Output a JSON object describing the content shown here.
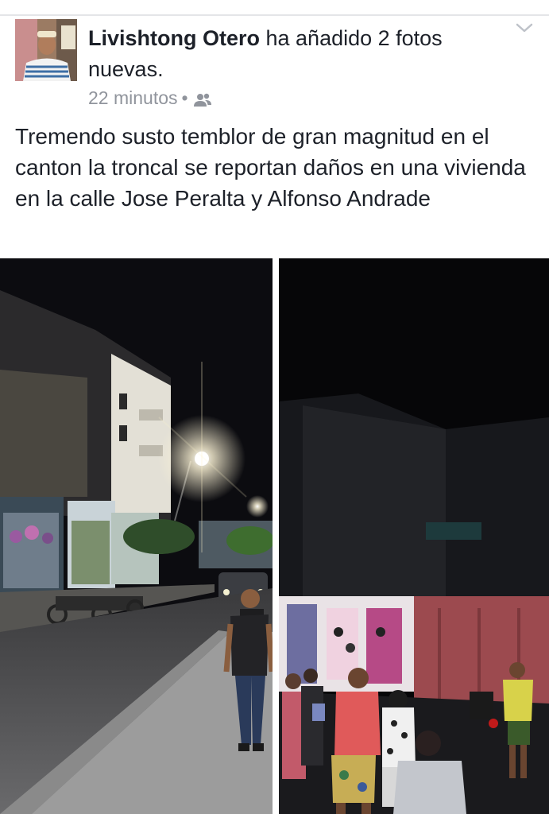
{
  "post": {
    "author": "Livishtong Otero",
    "action": " ha añadido 2 fotos nuevas.",
    "timestamp": "22 minutos",
    "separator": "•",
    "audience_icon": "friends-icon",
    "menu_icon": "chevron-down-icon",
    "text": "Tremendo susto temblor de gran magnitud  en el canton la troncal se reportan daños en una vivienda en la calle Jose Peralta y Alfonso Andrade"
  },
  "colors": {
    "text": "#1d2129",
    "meta": "#90949c",
    "divider": "#e4e5e8"
  }
}
